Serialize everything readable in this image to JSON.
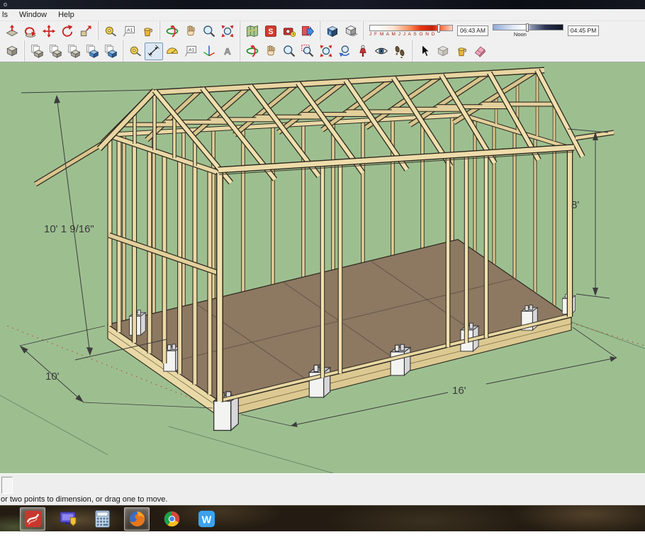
{
  "window": {
    "title_fragment": "o"
  },
  "menu": {
    "items": [
      {
        "label": "ls"
      },
      {
        "label": "Window"
      },
      {
        "label": "Help"
      }
    ]
  },
  "toolbars": {
    "row1_groups": [
      {
        "icons": [
          "push-pull",
          "follow-me",
          "move",
          "rotate",
          "scale"
        ]
      },
      {
        "icons": [
          "tape-measure",
          "text-annotation",
          "paint-bucket"
        ]
      },
      {
        "icons": [
          "orbit",
          "pan",
          "zoom",
          "zoom-extents"
        ]
      },
      {
        "icons": [
          "add-location",
          "share-model",
          "photo-match",
          "export"
        ]
      },
      {
        "icons": [
          "shadow-settings",
          "shadow-toggle"
        ]
      }
    ],
    "shadows": {
      "month_letters": "J F M A M J J A S O N D",
      "time_start": "06:43 AM",
      "noon_label": "Noon",
      "time_end": "04:45 PM"
    },
    "row2_groups": [
      {
        "icons": [
          "component-box"
        ]
      },
      {
        "icons": [
          "stack-tool-1",
          "stack-tool-2",
          "stack-tool-3",
          "stack-tool-blue-1",
          "stack-tool-blue-2"
        ]
      },
      {
        "icons": [
          "tape-measure",
          "dimension",
          "protractor",
          "text-annotation",
          "axes",
          "3d-text"
        ],
        "selected": "dimension"
      },
      {
        "icons": [
          "orbit",
          "pan",
          "zoom",
          "zoom-window",
          "zoom-extents",
          "previous-view",
          "position-camera",
          "look-around",
          "walk"
        ]
      },
      {
        "icons": [
          "select",
          "component-box-light",
          "paint-bucket",
          "eraser"
        ]
      }
    ]
  },
  "viewport": {
    "background_color": "#9dbf90",
    "model_description": "timber frame shed on pier blocks",
    "dimension_labels": {
      "height_overall": "10' 1 9/16\"",
      "wall_height": "8'",
      "width": "10'",
      "length": "16'"
    }
  },
  "status_bar": {
    "message": "or two points to dimension, or drag one to move."
  },
  "taskbar": {
    "apps": [
      {
        "name": "sketchup",
        "open": true
      },
      {
        "name": "media-app",
        "open": false
      },
      {
        "name": "calculator",
        "open": false
      },
      {
        "name": "firefox",
        "open": true
      },
      {
        "name": "chrome",
        "open": false
      },
      {
        "name": "wps-office",
        "open": false
      }
    ]
  }
}
